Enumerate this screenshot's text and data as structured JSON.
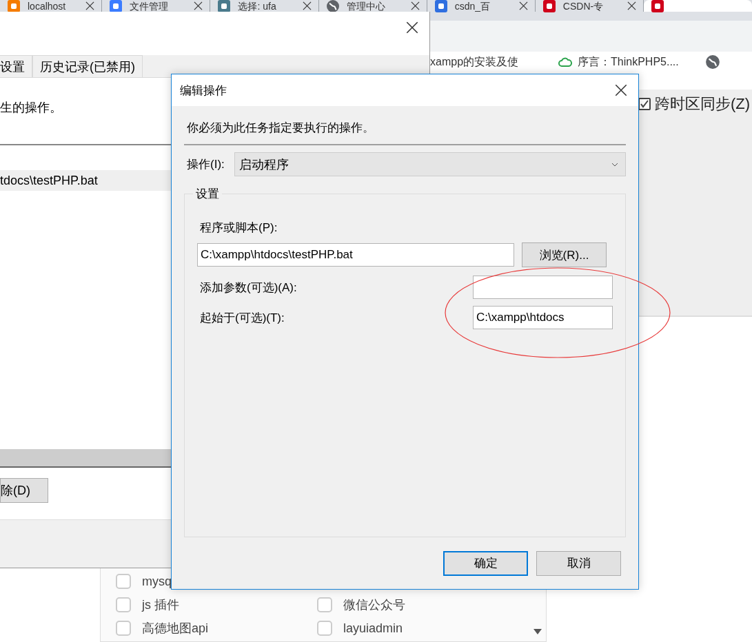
{
  "browser": {
    "tabs": [
      {
        "label": "localhost",
        "selected": false
      },
      {
        "label": "文件管理",
        "selected": false
      },
      {
        "label": "选择: ufa",
        "selected": false
      },
      {
        "label": "管理中心",
        "selected": false
      },
      {
        "label": "csdn_百",
        "selected": false
      },
      {
        "label": "CSDN-专",
        "selected": false
      },
      {
        "selected": true
      }
    ],
    "bookmarks": [
      {
        "label": "xampp的安装及使"
      },
      {
        "label": "序言：ThinkPHP5...."
      }
    ]
  },
  "page": {
    "timezone_sync": {
      "label": "跨时区同步(Z)",
      "checked": true
    },
    "tag_list": {
      "rows": [
        {
          "cells": [
            {
              "label": "mysq",
              "checked": false
            }
          ]
        },
        {
          "cells": [
            {
              "label": "js 插件",
              "checked": false
            },
            {
              "label": "微信公众号",
              "checked": false
            }
          ]
        },
        {
          "cells": [
            {
              "label": "高德地图api",
              "checked": false
            },
            {
              "label": "layuiadmin",
              "checked": false
            }
          ]
        }
      ]
    }
  },
  "background_dialog": {
    "tabs": [
      {
        "label": "设置",
        "selected": false
      },
      {
        "label": "历史记录(已禁用)",
        "selected": false
      }
    ],
    "description": "生的操作。",
    "actions": [
      {
        "label": "tdocs\\testPHP.bat",
        "selected": true
      }
    ],
    "buttons": [
      {
        "label": "除(D)"
      }
    ]
  },
  "dialog": {
    "title": "编辑操作",
    "instruction": "你必须为此任务指定要执行的操作。",
    "action": {
      "label": "操作(I):",
      "value": "启动程序"
    },
    "settings": {
      "legend": "设置",
      "program": {
        "label": "程序或脚本(P):",
        "value": "C:\\xampp\\htdocs\\testPHP.bat",
        "browse_button": "浏览(R)..."
      },
      "arguments": {
        "label": "添加参数(可选)(A):"
      },
      "start_in": {
        "label": "起始于(可选)(T):",
        "value": "C:\\xampp\\htdocs"
      }
    },
    "buttons": [
      {
        "label": "确定",
        "default": true
      },
      {
        "label": "取消",
        "default": false
      }
    ]
  }
}
